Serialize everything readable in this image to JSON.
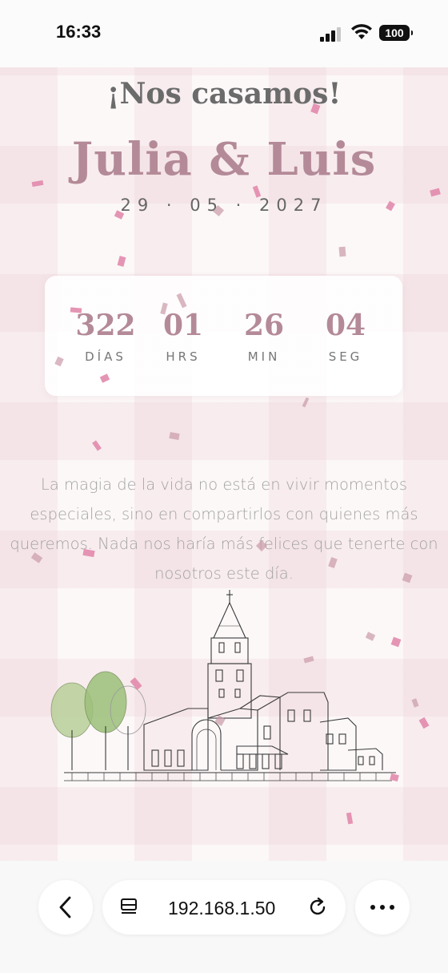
{
  "status_bar": {
    "time": "16:33",
    "battery": "100"
  },
  "hero": {
    "kicker": "¡Nos casamos!",
    "names": "Julia & Luis",
    "date": "29 · 05 · 2027"
  },
  "countdown": {
    "units": [
      {
        "value": "322",
        "label": "DÍAS"
      },
      {
        "value": "01",
        "label": "HRS"
      },
      {
        "value": "26",
        "label": "MIN"
      },
      {
        "value": "04",
        "label": "SEG"
      }
    ]
  },
  "message": "La magia de la vida no está en vivir momentos especiales, sino en compartirlos con quienes más queremos. Nada nos haría más felices que tenerte con nosotros este día.",
  "browser": {
    "url": "192.168.1.50",
    "back_icon": "chevron-left-icon",
    "tabs_icon": "page-tabs-icon",
    "reload_icon": "reload-icon",
    "more_icon": "more-dots-icon"
  },
  "colors": {
    "accent": "#b48a98",
    "confetti": "#e38aac"
  }
}
